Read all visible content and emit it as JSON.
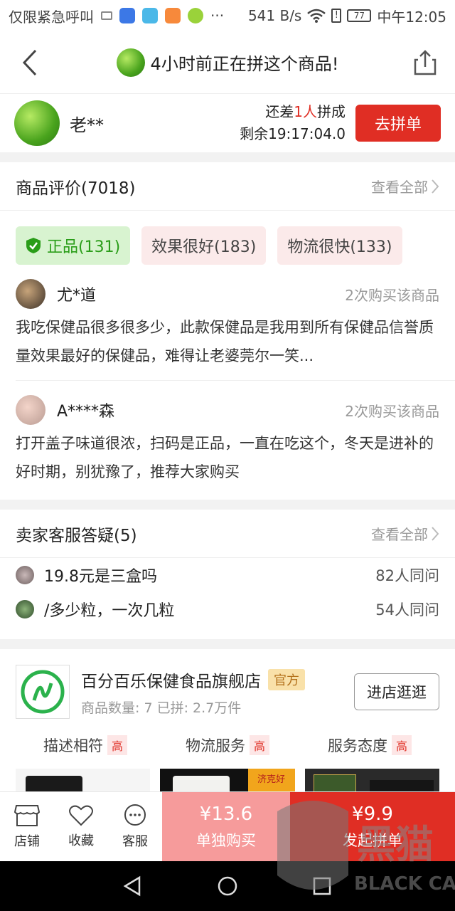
{
  "statusbar": {
    "left_text": "仅限紧急呼叫",
    "net_speed": "541 B/s",
    "battery": "77",
    "time": "中午12:05"
  },
  "nav": {
    "title": "4小时前正在拼这个商品!",
    "back_icon": "chevron-left-icon",
    "share_icon": "share-icon"
  },
  "group": {
    "user": "老**",
    "need_prefix": "还差",
    "need_count": "1人",
    "need_suffix": "拼成",
    "remaining": "剩余19:17:04.0",
    "join_label": "去拼单"
  },
  "reviews": {
    "title": "商品评价(7018)",
    "more": "查看全部",
    "tags": [
      "正品(131)",
      "效果很好(183)",
      "物流很快(133)"
    ],
    "items": [
      {
        "name": "尤*道",
        "count": "2次购买该商品",
        "text": "我吃保健品很多很多少，此款保健品是我用到所有保健品信誉质量效果最好的保健品，难得让老婆莞尔一笑..."
      },
      {
        "name": "A****森",
        "count": "2次购买该商品",
        "text": "打开盖子味道很浓，扫码是正品，一直在吃这个，冬天是进补的好时期，别犹豫了，推荐大家购买"
      }
    ]
  },
  "qa": {
    "title": "卖家客服答疑(5)",
    "more": "查看全部",
    "items": [
      {
        "q": "19.8元是三盒吗",
        "count": "82人同问"
      },
      {
        "q": "/多少粒，一次几粒",
        "count": "54人同问"
      }
    ]
  },
  "store": {
    "name": "百分百乐保健食品旗舰店",
    "badge": "官方",
    "meta": "商品数量: 7   已拼: 2.7万件",
    "enter": "进店逛逛",
    "ratings": [
      {
        "label": "描述相符",
        "level": "高"
      },
      {
        "label": "物流服务",
        "level": "高"
      },
      {
        "label": "服务态度",
        "level": "高"
      }
    ],
    "thumb_label": "济克好"
  },
  "bottom": {
    "tabs": [
      "店铺",
      "收藏",
      "客服"
    ],
    "alone_price": "¥13.6",
    "alone_label": "单独购买",
    "group_price": "¥9.9",
    "group_label": "发起拼单"
  },
  "watermark": {
    "text": "BLACK CAT"
  },
  "colors": {
    "accent": "#e02e24",
    "green": "#2a9d19",
    "light_red": "#f69b9b"
  }
}
